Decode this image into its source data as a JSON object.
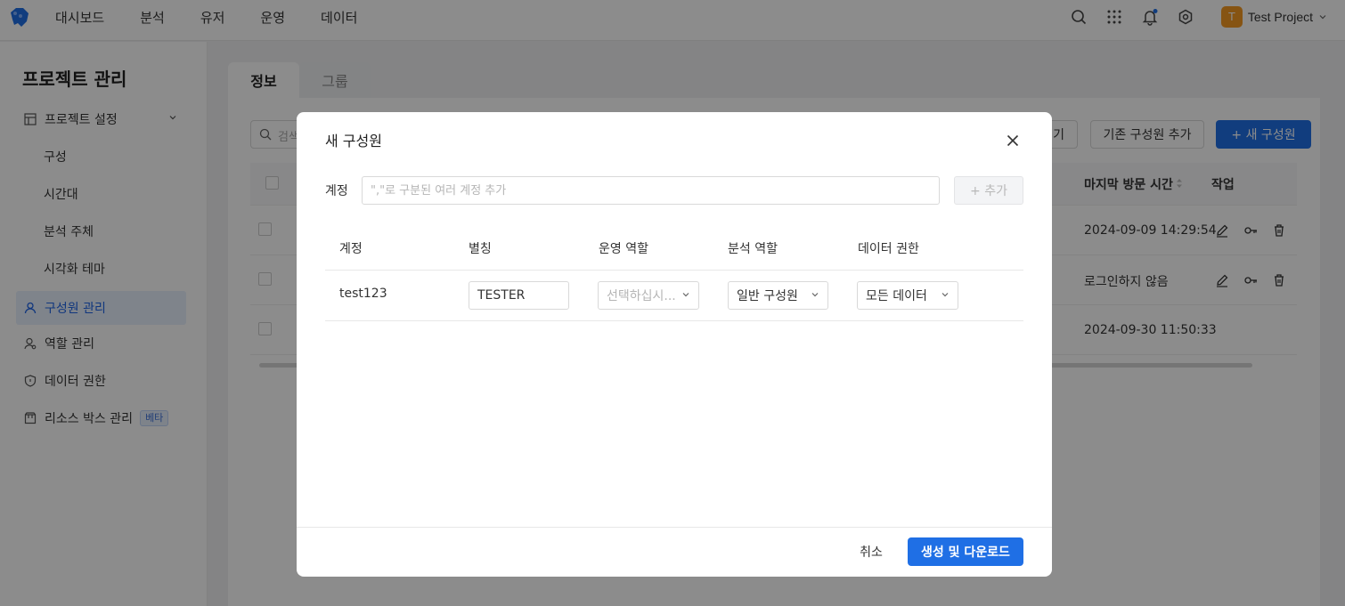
{
  "topbar": {
    "nav": [
      "대시보드",
      "분석",
      "유저",
      "운영",
      "데이터"
    ],
    "project_avatar": "T",
    "project_name": "Test Project",
    "icons": [
      "search-icon",
      "apps-grid-icon",
      "bell-icon",
      "settings-icon",
      "chevron-down-icon"
    ],
    "accent": "#1f6fe5"
  },
  "sidebar": {
    "title": "프로젝트 관리",
    "items": [
      {
        "label": "프로젝트 설정",
        "icon": "layout-icon"
      },
      {
        "label": "구성"
      },
      {
        "label": "시간대"
      },
      {
        "label": "분석 주체"
      },
      {
        "label": "시각화 테마"
      },
      {
        "label": "구성원 관리",
        "icon": "user-icon",
        "active": true
      },
      {
        "label": "역할 관리",
        "icon": "user-role-icon"
      },
      {
        "label": "데이터 권한",
        "icon": "shield-icon"
      },
      {
        "label": "리소스 박스 관리",
        "icon": "box-icon",
        "badge": "베타"
      }
    ]
  },
  "main": {
    "tabs": [
      "정보",
      "그룹"
    ],
    "search_placeholder": "검색",
    "buttons": {
      "partial": "기",
      "add_existing": "기존 구성원 추가",
      "new_member": "+ 새 구성원"
    },
    "columns": {
      "last_visit": "마지막 방문 시간",
      "action": "작업"
    },
    "rows": [
      {
        "last_visit": "2024-09-09 14:29:54"
      },
      {
        "last_visit": "로그인하지 않음"
      },
      {
        "last_visit": "2024-09-30 11:50:33"
      }
    ]
  },
  "modal": {
    "title": "새 구성원",
    "account_label": "계정",
    "account_placeholder": "\",\"로 구분된 여러 계정 추가",
    "add_button": "+ 추가",
    "columns": [
      "계정",
      "별칭",
      "운영 역할",
      "분석 역할",
      "데이터 권한"
    ],
    "row": {
      "account": "test123",
      "alias": "TESTER",
      "ops_role_placeholder": "선택하십시...",
      "analysis_role": "일반 구성원",
      "data_permission": "모든 데이터"
    },
    "cancel": "취소",
    "submit": "생성 및 다운로드"
  }
}
